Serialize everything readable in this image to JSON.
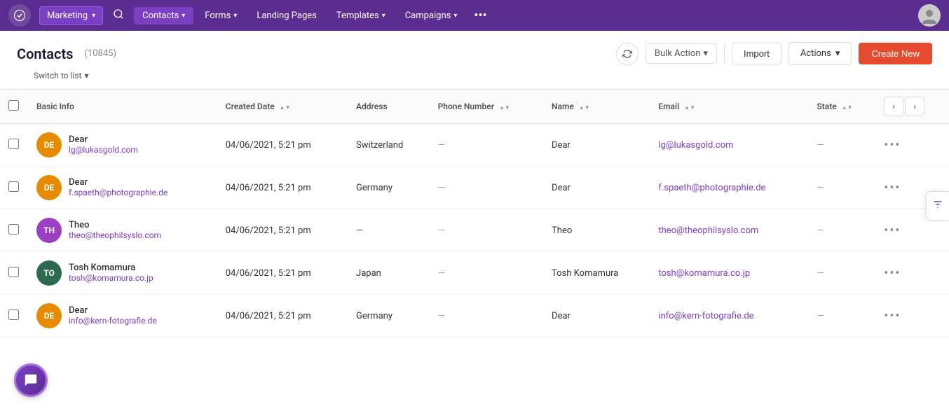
{
  "topnav": {
    "marketing_label": "Marketing",
    "contacts_label": "Contacts",
    "forms_label": "Forms",
    "landing_pages_label": "Landing Pages",
    "templates_label": "Templates",
    "campaigns_label": "Campaigns",
    "more_icon": "•••"
  },
  "header": {
    "title": "Contacts",
    "count": "(10845)",
    "switch_list_label": "Switch to list",
    "bulk_action_label": "Bulk Action",
    "import_label": "Import",
    "actions_label": "Actions",
    "create_new_label": "Create New"
  },
  "table": {
    "columns": [
      {
        "id": "basic_info",
        "label": "Basic Info"
      },
      {
        "id": "created_date",
        "label": "Created Date"
      },
      {
        "id": "address",
        "label": "Address"
      },
      {
        "id": "phone_number",
        "label": "Phone Number"
      },
      {
        "id": "name",
        "label": "Name"
      },
      {
        "id": "email",
        "label": "Email"
      },
      {
        "id": "state",
        "label": "State"
      }
    ],
    "rows": [
      {
        "id": 1,
        "avatar_initials": "DE",
        "avatar_color": "#e68a00",
        "first_name": "Dear",
        "email_sub": "lg@lukasgold.com",
        "created_date": "04/06/2021, 5:21 pm",
        "address": "Switzerland",
        "phone": "—",
        "name": "Dear",
        "email": "lg@lukasgold.com",
        "state": "—"
      },
      {
        "id": 2,
        "avatar_initials": "DE",
        "avatar_color": "#e68a00",
        "first_name": "Dear",
        "email_sub": "f.spaeth@photographie.de",
        "created_date": "04/06/2021, 5:21 pm",
        "address": "Germany",
        "phone": "—",
        "name": "Dear",
        "email": "f.spaeth@photographie.de",
        "state": "—"
      },
      {
        "id": 3,
        "avatar_initials": "TH",
        "avatar_color": "#9b3fc4",
        "first_name": "Theo",
        "email_sub": "theo@theophilsyslo.com",
        "created_date": "04/06/2021, 5:21 pm",
        "address": "—",
        "phone": "—",
        "name": "Theo",
        "email": "theo@theophilsyslo.com",
        "state": "—"
      },
      {
        "id": 4,
        "avatar_initials": "TO",
        "avatar_color": "#2d6a4f",
        "first_name": "Tosh Komamura",
        "email_sub": "tosh@komamura.co.jp",
        "created_date": "04/06/2021, 5:21 pm",
        "address": "Japan",
        "phone": "—",
        "name": "Tosh Komamura",
        "email": "tosh@komamura.co.jp",
        "state": "—"
      },
      {
        "id": 5,
        "avatar_initials": "DE",
        "avatar_color": "#e68a00",
        "first_name": "Dear",
        "email_sub": "info@kern-fotografie.de",
        "created_date": "04/06/2021, 5:21 pm",
        "address": "Germany",
        "phone": "—",
        "name": "Dear",
        "email": "info@kern-fotografie.de",
        "state": "—"
      }
    ]
  }
}
